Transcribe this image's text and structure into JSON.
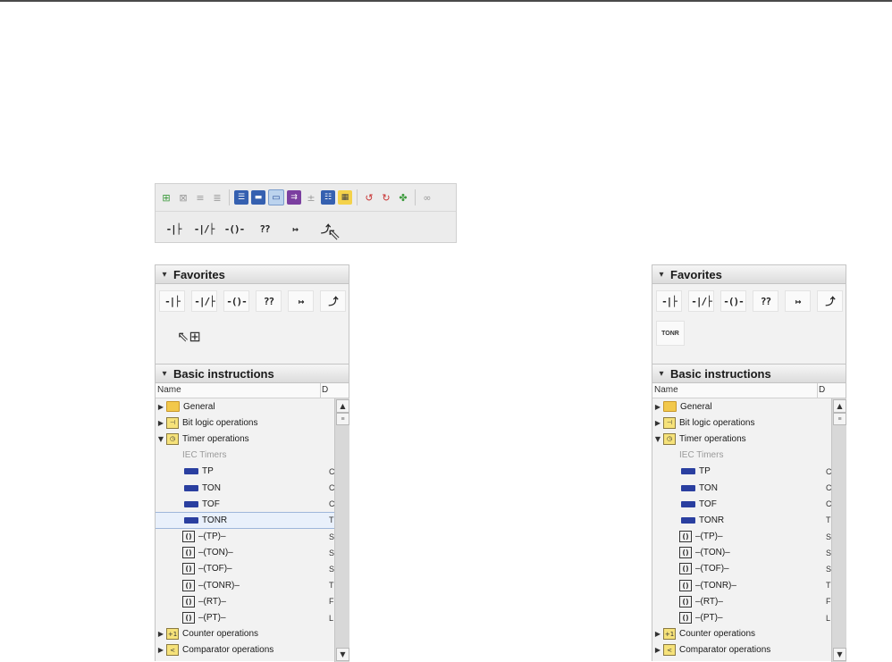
{
  "toolbar": {
    "icons_row1": [
      "network-insert-icon",
      "network-delete-icon",
      "insert-row-icon",
      "insert-column-icon",
      "absolute-operand-icon",
      "favorites-toggle-icon",
      "comments-toggle-icon",
      "open-branch-icon",
      "close-branch-icon",
      "networks-collapse-icon",
      "highlight-icon",
      "go-online-icon",
      "go-offline-icon",
      "monitor-icon",
      "watch-icon"
    ],
    "favorites": [
      {
        "name": "no-contact",
        "glyph": "-|├"
      },
      {
        "name": "nc-contact",
        "glyph": "-|/├"
      },
      {
        "name": "coil",
        "glyph": "-()-"
      },
      {
        "name": "empty-box",
        "glyph": "??"
      },
      {
        "name": "open-branch",
        "glyph": "↦"
      },
      {
        "name": "close-branch",
        "glyph": "⤴"
      }
    ]
  },
  "panels": {
    "favorites_title": "Favorites",
    "basic_title": "Basic instructions",
    "tonr_fav": "TONR",
    "column_name": "Name",
    "column_d": "D",
    "tree": [
      {
        "label": "General",
        "icon": "folder",
        "tri": "right",
        "d": ""
      },
      {
        "label": "Bit logic operations",
        "icon": "bitlogic",
        "tri": "right",
        "d": ""
      },
      {
        "label": "Timer operations",
        "icon": "timer",
        "tri": "down",
        "d": ""
      },
      {
        "label": "IEC Timers",
        "icon": "none",
        "tri": "",
        "d": "",
        "gray": true
      },
      {
        "label": "TP",
        "icon": "block",
        "tri": "",
        "d": "C"
      },
      {
        "label": "TON",
        "icon": "block",
        "tri": "",
        "d": "C"
      },
      {
        "label": "TOF",
        "icon": "block",
        "tri": "",
        "d": "C"
      },
      {
        "label": "TONR",
        "icon": "block",
        "tri": "",
        "d": "T",
        "selected": true
      },
      {
        "label": "–(TP)–",
        "icon": "coil",
        "tri": "",
        "d": "S"
      },
      {
        "label": "–(TON)–",
        "icon": "coil",
        "tri": "",
        "d": "S"
      },
      {
        "label": "–(TOF)–",
        "icon": "coil",
        "tri": "",
        "d": "S"
      },
      {
        "label": "–(TONR)–",
        "icon": "coil",
        "tri": "",
        "d": "T"
      },
      {
        "label": "–(RT)–",
        "icon": "coil",
        "tri": "",
        "d": "F"
      },
      {
        "label": "–(PT)–",
        "icon": "coil",
        "tri": "",
        "d": "L"
      },
      {
        "label": "Counter operations",
        "icon": "counter",
        "tri": "right",
        "d": ""
      },
      {
        "label": "Comparator operations",
        "icon": "comparator",
        "tri": "right",
        "d": ""
      }
    ]
  }
}
